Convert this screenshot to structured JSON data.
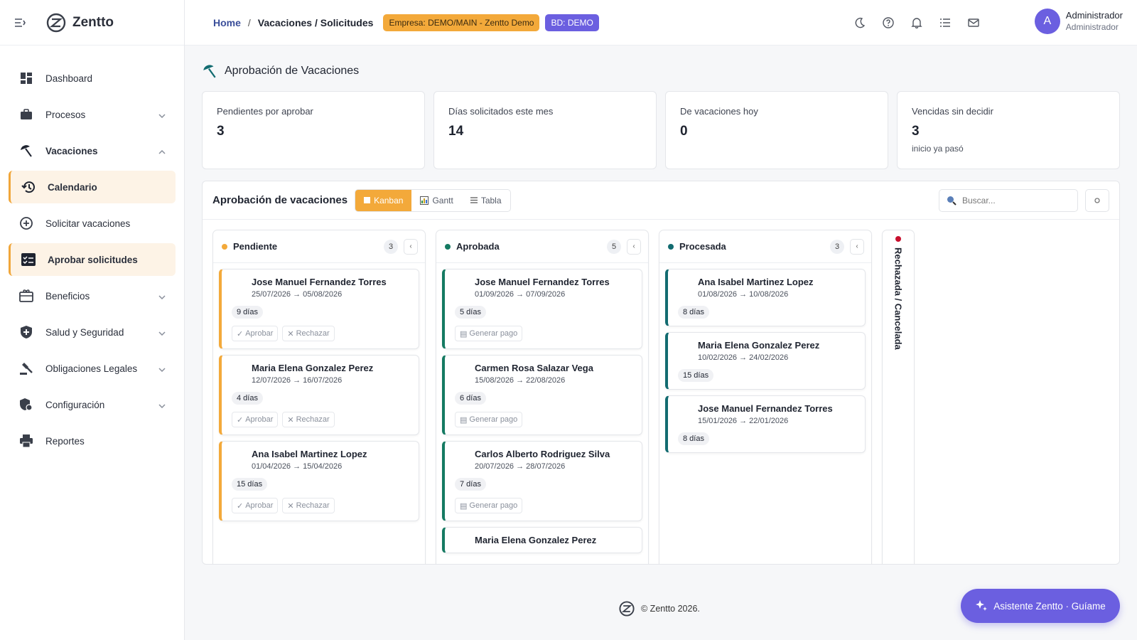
{
  "app": {
    "name": "Zentto"
  },
  "sidebar": {
    "items": [
      {
        "label": "Dashboard"
      },
      {
        "label": "Procesos"
      },
      {
        "label": "Vacaciones"
      },
      {
        "label": "Calendario"
      },
      {
        "label": "Solicitar vacaciones"
      },
      {
        "label": "Aprobar solicitudes"
      },
      {
        "label": "Beneficios"
      },
      {
        "label": "Salud y Seguridad"
      },
      {
        "label": "Obligaciones Legales"
      },
      {
        "label": "Configuración"
      },
      {
        "label": "Reportes"
      }
    ]
  },
  "header": {
    "breadcrumb": {
      "home": "Home",
      "separator": "/",
      "current": "Vacaciones / Solicitudes"
    },
    "badge_company": "Empresa: DEMO/MAIN - Zentto Demo",
    "badge_db": "BD: DEMO",
    "user": {
      "initial": "A",
      "name": "Administrador",
      "role": "Administrador"
    }
  },
  "page": {
    "title": "Aprobación de Vacaciones"
  },
  "stats": [
    {
      "label": "Pendientes por aprobar",
      "value": "3",
      "sub": ""
    },
    {
      "label": "Días solicitados este mes",
      "value": "14",
      "sub": ""
    },
    {
      "label": "De vacaciones hoy",
      "value": "0",
      "sub": ""
    },
    {
      "label": "Vencidas sin decidir",
      "value": "3",
      "sub": "inicio ya pasó"
    }
  ],
  "board": {
    "title": "Aprobación de vacaciones",
    "views": {
      "kanban": "Kanban",
      "gantt": "Gantt",
      "tabla": "Tabla"
    },
    "search_placeholder": "Buscar...",
    "columns": {
      "pendiente": {
        "title": "Pendiente",
        "count": "3",
        "color": "#f3a93a",
        "cards": [
          {
            "name": "Jose Manuel Fernandez Torres",
            "dates": "25/07/2026 → 05/08/2026",
            "days": "9 días"
          },
          {
            "name": "Maria Elena Gonzalez Perez",
            "dates": "12/07/2026 → 16/07/2026",
            "days": "4 días"
          },
          {
            "name": "Ana Isabel Martinez Lopez",
            "dates": "01/04/2026 → 15/04/2026",
            "days": "15 días"
          }
        ]
      },
      "aprobada": {
        "title": "Aprobada",
        "count": "5",
        "color": "#157a62",
        "cards": [
          {
            "name": "Jose Manuel Fernandez Torres",
            "dates": "01/09/2026 → 07/09/2026",
            "days": "5 días"
          },
          {
            "name": "Carmen Rosa Salazar Vega",
            "dates": "15/08/2026 → 22/08/2026",
            "days": "6 días"
          },
          {
            "name": "Carlos Alberto Rodriguez Silva",
            "dates": "20/07/2026 → 28/07/2026",
            "days": "7 días"
          },
          {
            "name": "Maria Elena Gonzalez Perez"
          }
        ]
      },
      "procesada": {
        "title": "Procesada",
        "count": "3",
        "color": "#126b70",
        "cards": [
          {
            "name": "Ana Isabel Martinez Lopez",
            "dates": "01/08/2026 → 10/08/2026",
            "days": "8 días"
          },
          {
            "name": "Maria Elena Gonzalez Perez",
            "dates": "10/02/2026 → 24/02/2026",
            "days": "15 días"
          },
          {
            "name": "Jose Manuel Fernandez Torres",
            "dates": "15/01/2026 → 22/01/2026",
            "days": "8 días"
          }
        ]
      },
      "rechazada": {
        "title": "Rechazada / Cancelada",
        "color": "#c8102e"
      }
    },
    "actions": {
      "approve": "Aprobar",
      "reject": "Rechazar",
      "pay": "Generar pago"
    }
  },
  "footer": {
    "text": "© Zentto 2026."
  },
  "assistant": {
    "label": "Asistente Zentto · Guíame"
  },
  "colors": {
    "accent": "#f3a93a",
    "primary": "#6b5fe0",
    "approved": "#157a62",
    "processed": "#126b70",
    "rejected": "#c8102e"
  }
}
